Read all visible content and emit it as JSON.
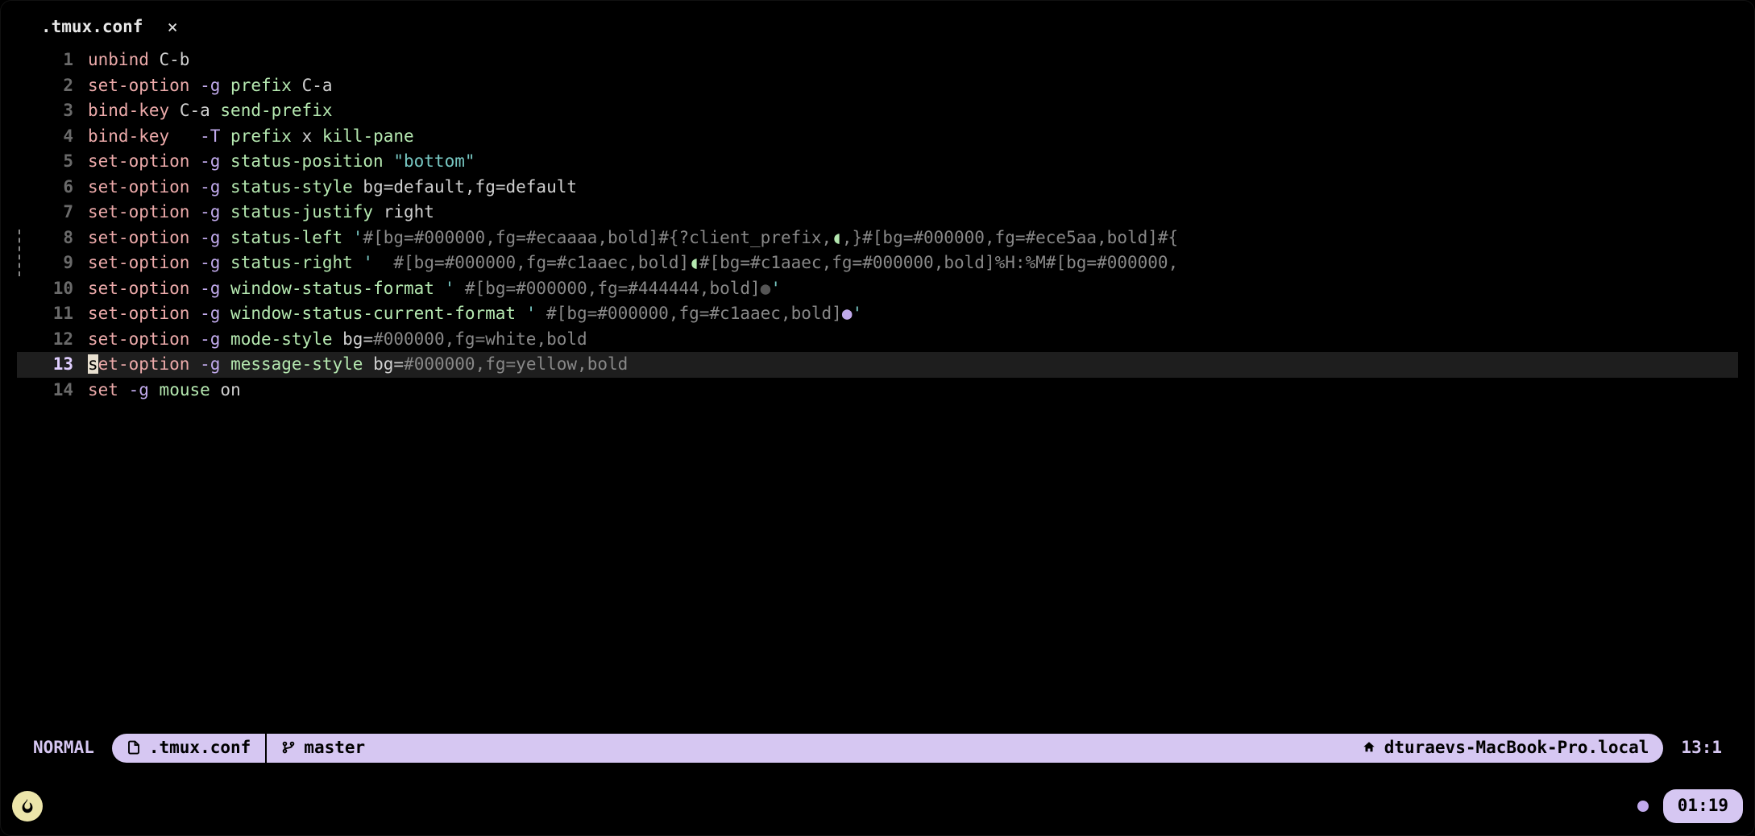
{
  "tab": {
    "filename": ".tmux.conf",
    "close_label": "×"
  },
  "gutter": [
    "1",
    "2",
    "3",
    "4",
    "5",
    "6",
    "7",
    "8",
    "9",
    "10",
    "11",
    "12",
    "13",
    "14"
  ],
  "cursor": {
    "line": 13,
    "col": 1
  },
  "lines": {
    "l1": [
      {
        "t": "unbind",
        "c": "kw"
      },
      {
        "t": " "
      },
      {
        "t": "C-b",
        "c": "arg"
      }
    ],
    "l2": [
      {
        "t": "set-option",
        "c": "kw"
      },
      {
        "t": " "
      },
      {
        "t": "-g",
        "c": "flag"
      },
      {
        "t": " "
      },
      {
        "t": "prefix",
        "c": "word"
      },
      {
        "t": " "
      },
      {
        "t": "C-a",
        "c": "arg"
      }
    ],
    "l3": [
      {
        "t": "bind-key",
        "c": "kw"
      },
      {
        "t": " "
      },
      {
        "t": "C-a",
        "c": "arg"
      },
      {
        "t": " "
      },
      {
        "t": "send-prefix",
        "c": "word"
      }
    ],
    "l4": [
      {
        "t": "bind-key",
        "c": "kw"
      },
      {
        "t": "   "
      },
      {
        "t": "-T",
        "c": "flag"
      },
      {
        "t": " "
      },
      {
        "t": "prefix",
        "c": "word"
      },
      {
        "t": " "
      },
      {
        "t": "x",
        "c": "arg"
      },
      {
        "t": " "
      },
      {
        "t": "kill-pane",
        "c": "word"
      }
    ],
    "l5": [
      {
        "t": "set-option",
        "c": "kw"
      },
      {
        "t": " "
      },
      {
        "t": "-g",
        "c": "flag"
      },
      {
        "t": " "
      },
      {
        "t": "status-position",
        "c": "word"
      },
      {
        "t": " "
      },
      {
        "t": "\"bottom\"",
        "c": "str"
      }
    ],
    "l6": [
      {
        "t": "set-option",
        "c": "kw"
      },
      {
        "t": " "
      },
      {
        "t": "-g",
        "c": "flag"
      },
      {
        "t": " "
      },
      {
        "t": "status-style",
        "c": "word"
      },
      {
        "t": " "
      },
      {
        "t": "bg",
        "c": "arg"
      },
      {
        "t": "=",
        "c": "sym"
      },
      {
        "t": "default",
        "c": "arg"
      },
      {
        "t": ",",
        "c": "sym"
      },
      {
        "t": "fg",
        "c": "arg"
      },
      {
        "t": "=",
        "c": "sym"
      },
      {
        "t": "default",
        "c": "arg"
      }
    ],
    "l7": [
      {
        "t": "set-option",
        "c": "kw"
      },
      {
        "t": " "
      },
      {
        "t": "-g",
        "c": "flag"
      },
      {
        "t": " "
      },
      {
        "t": "status-justify",
        "c": "word"
      },
      {
        "t": " "
      },
      {
        "t": "right",
        "c": "arg"
      }
    ],
    "l8": [
      {
        "t": "set-option",
        "c": "kw"
      },
      {
        "t": " "
      },
      {
        "t": "-g",
        "c": "flag"
      },
      {
        "t": " "
      },
      {
        "t": "status-left",
        "c": "word"
      },
      {
        "t": " "
      },
      {
        "t": "'",
        "c": "quote"
      },
      {
        "t": "#[",
        "c": "gray"
      },
      {
        "t": "bg",
        "c": "gray"
      },
      {
        "t": "=",
        "c": "gray"
      },
      {
        "t": "#000000",
        "c": "gray"
      },
      {
        "t": ",",
        "c": "gray"
      },
      {
        "t": "fg",
        "c": "gray"
      },
      {
        "t": "=",
        "c": "gray"
      },
      {
        "t": "#ecaaaa",
        "c": "gray"
      },
      {
        "t": ",",
        "c": "gray"
      },
      {
        "t": "bold",
        "c": "gray"
      },
      {
        "t": "]",
        "c": "gray"
      },
      {
        "t": "#{",
        "c": "gray"
      },
      {
        "t": "?client_prefix,",
        "c": "gray"
      },
      {
        "t": "◖",
        "c": "word"
      },
      {
        "t": ",}",
        "c": "gray"
      },
      {
        "t": "#[",
        "c": "gray"
      },
      {
        "t": "bg",
        "c": "gray"
      },
      {
        "t": "=",
        "c": "gray"
      },
      {
        "t": "#000000",
        "c": "gray"
      },
      {
        "t": ",",
        "c": "gray"
      },
      {
        "t": "fg",
        "c": "gray"
      },
      {
        "t": "=",
        "c": "gray"
      },
      {
        "t": "#ece5aa",
        "c": "gray"
      },
      {
        "t": ",",
        "c": "gray"
      },
      {
        "t": "bold",
        "c": "gray"
      },
      {
        "t": "]",
        "c": "gray"
      },
      {
        "t": "#{",
        "c": "gray"
      }
    ],
    "l9": [
      {
        "t": "set-option",
        "c": "kw"
      },
      {
        "t": " "
      },
      {
        "t": "-g",
        "c": "flag"
      },
      {
        "t": " "
      },
      {
        "t": "status-right",
        "c": "word"
      },
      {
        "t": " "
      },
      {
        "t": "'",
        "c": "quote"
      },
      {
        "t": "  "
      },
      {
        "t": "#[",
        "c": "gray"
      },
      {
        "t": "bg",
        "c": "gray"
      },
      {
        "t": "=",
        "c": "gray"
      },
      {
        "t": "#000000",
        "c": "gray"
      },
      {
        "t": ",",
        "c": "gray"
      },
      {
        "t": "fg",
        "c": "gray"
      },
      {
        "t": "=",
        "c": "gray"
      },
      {
        "t": "#c1aaec",
        "c": "gray"
      },
      {
        "t": ",",
        "c": "gray"
      },
      {
        "t": "bold",
        "c": "gray"
      },
      {
        "t": "]",
        "c": "gray"
      },
      {
        "t": "◖",
        "c": "word"
      },
      {
        "t": "#[",
        "c": "gray"
      },
      {
        "t": "bg",
        "c": "gray"
      },
      {
        "t": "=",
        "c": "gray"
      },
      {
        "t": "#c1aaec",
        "c": "gray"
      },
      {
        "t": ",",
        "c": "gray"
      },
      {
        "t": "fg",
        "c": "gray"
      },
      {
        "t": "=",
        "c": "gray"
      },
      {
        "t": "#000000",
        "c": "gray"
      },
      {
        "t": ",",
        "c": "gray"
      },
      {
        "t": "bold",
        "c": "gray"
      },
      {
        "t": "]",
        "c": "gray"
      },
      {
        "t": "%H:%M",
        "c": "gray"
      },
      {
        "t": "#[",
        "c": "gray"
      },
      {
        "t": "bg",
        "c": "gray"
      },
      {
        "t": "=",
        "c": "gray"
      },
      {
        "t": "#000000",
        "c": "gray"
      },
      {
        "t": ",",
        "c": "gray"
      }
    ],
    "l10": [
      {
        "t": "set-option",
        "c": "kw"
      },
      {
        "t": " "
      },
      {
        "t": "-g",
        "c": "flag"
      },
      {
        "t": " "
      },
      {
        "t": "window-status-format",
        "c": "word"
      },
      {
        "t": " "
      },
      {
        "t": "'",
        "c": "quote"
      },
      {
        "t": " "
      },
      {
        "t": "#[",
        "c": "gray"
      },
      {
        "t": "bg",
        "c": "gray"
      },
      {
        "t": "=",
        "c": "gray"
      },
      {
        "t": "#000000",
        "c": "gray"
      },
      {
        "t": ",",
        "c": "gray"
      },
      {
        "t": "fg",
        "c": "gray"
      },
      {
        "t": "=",
        "c": "gray"
      },
      {
        "t": "#444444",
        "c": "gray"
      },
      {
        "t": ",",
        "c": "gray"
      },
      {
        "t": "bold",
        "c": "gray"
      },
      {
        "t": "]",
        "c": "gray"
      },
      {
        "t": "●",
        "c": "dot-dim"
      },
      {
        "t": "'",
        "c": "quote"
      }
    ],
    "l11": [
      {
        "t": "set-option",
        "c": "kw"
      },
      {
        "t": " "
      },
      {
        "t": "-g",
        "c": "flag"
      },
      {
        "t": " "
      },
      {
        "t": "window-status-current-format",
        "c": "word"
      },
      {
        "t": " "
      },
      {
        "t": "'",
        "c": "quote"
      },
      {
        "t": " "
      },
      {
        "t": "#[",
        "c": "gray"
      },
      {
        "t": "bg",
        "c": "gray"
      },
      {
        "t": "=",
        "c": "gray"
      },
      {
        "t": "#000000",
        "c": "gray"
      },
      {
        "t": ",",
        "c": "gray"
      },
      {
        "t": "fg",
        "c": "gray"
      },
      {
        "t": "=",
        "c": "gray"
      },
      {
        "t": "#c1aaec",
        "c": "gray"
      },
      {
        "t": ",",
        "c": "gray"
      },
      {
        "t": "bold",
        "c": "gray"
      },
      {
        "t": "]",
        "c": "gray"
      },
      {
        "t": "●",
        "c": "dot-accent"
      },
      {
        "t": "'",
        "c": "quote"
      }
    ],
    "l12": [
      {
        "t": "set-option",
        "c": "kw"
      },
      {
        "t": " "
      },
      {
        "t": "-g",
        "c": "flag"
      },
      {
        "t": " "
      },
      {
        "t": "mode-style",
        "c": "word"
      },
      {
        "t": " "
      },
      {
        "t": "bg",
        "c": "arg"
      },
      {
        "t": "=",
        "c": "sym"
      },
      {
        "t": "#000000",
        "c": "gray"
      },
      {
        "t": ",",
        "c": "gray"
      },
      {
        "t": "fg",
        "c": "gray"
      },
      {
        "t": "=",
        "c": "gray"
      },
      {
        "t": "white",
        "c": "gray"
      },
      {
        "t": ",",
        "c": "gray"
      },
      {
        "t": "bold",
        "c": "gray"
      }
    ],
    "l13": [
      {
        "t": "s",
        "c": "cursor"
      },
      {
        "t": "et-option",
        "c": "kw"
      },
      {
        "t": " "
      },
      {
        "t": "-g",
        "c": "flag"
      },
      {
        "t": " "
      },
      {
        "t": "message-style",
        "c": "word"
      },
      {
        "t": " "
      },
      {
        "t": "bg",
        "c": "arg"
      },
      {
        "t": "=",
        "c": "sym"
      },
      {
        "t": "#000000",
        "c": "gray"
      },
      {
        "t": ",",
        "c": "gray"
      },
      {
        "t": "fg",
        "c": "gray"
      },
      {
        "t": "=",
        "c": "gray"
      },
      {
        "t": "yellow",
        "c": "gray"
      },
      {
        "t": ",",
        "c": "gray"
      },
      {
        "t": "bold",
        "c": "gray"
      }
    ],
    "l14": [
      {
        "t": "set",
        "c": "kw"
      },
      {
        "t": " "
      },
      {
        "t": "-g",
        "c": "flag"
      },
      {
        "t": " "
      },
      {
        "t": "mouse",
        "c": "word"
      },
      {
        "t": " "
      },
      {
        "t": "on",
        "c": "arg"
      }
    ]
  },
  "statusline": {
    "mode": "NORMAL",
    "file_icon": "file-icon",
    "filename": ".tmux.conf",
    "branch_icon": "branch-icon",
    "branch": "master",
    "host_icon": "home-icon",
    "host": "dturaevs-MacBook-Pro.local",
    "position": "13:1"
  },
  "tmuxbar": {
    "left_icon": "flame-icon",
    "left_icon_glyph": "♨",
    "clock": "01:19"
  }
}
